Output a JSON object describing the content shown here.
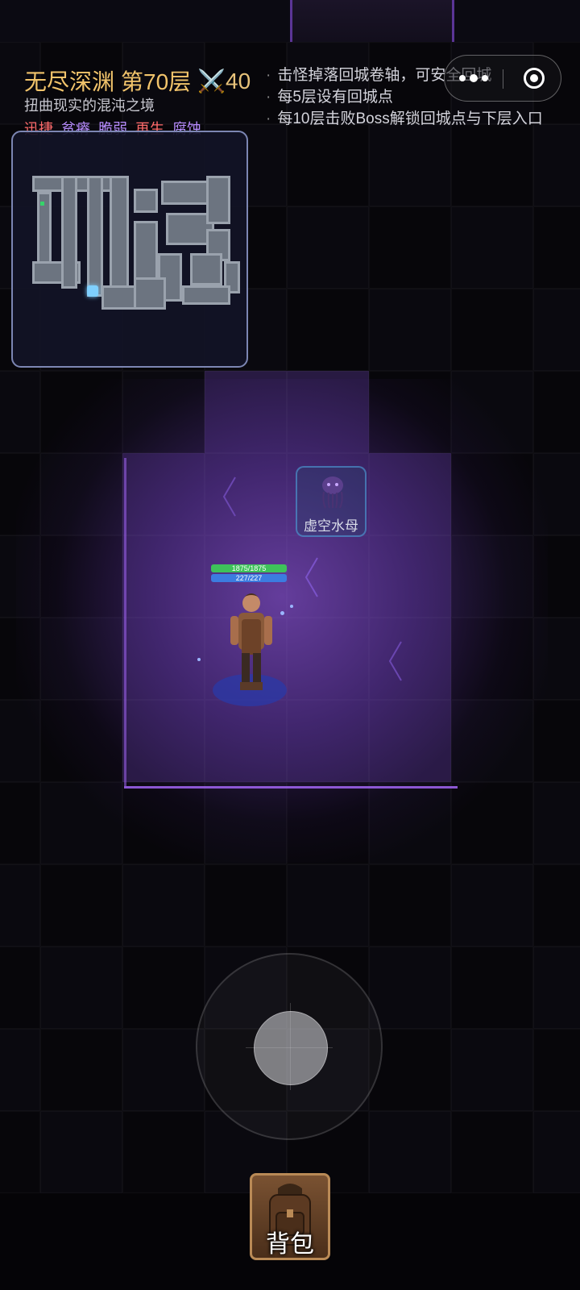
{
  "hud": {
    "dungeon_name": "无尽深渊",
    "floor": "第70层",
    "power": "⚔️40",
    "subtitle": "扭曲现实的混沌之境",
    "affixes": [
      {
        "label": "迅捷",
        "color": "#ff6b6b"
      },
      {
        "label": "贫瘠",
        "color": "#b88cff"
      },
      {
        "label": "脆弱",
        "color": "#b88cff"
      },
      {
        "label": "再生",
        "color": "#ff6b6b"
      },
      {
        "label": "腐蚀",
        "color": "#b88cff"
      }
    ]
  },
  "tips": [
    "击怪掉落回城卷轴，可安全回城",
    "每5层设有回城点",
    "每10层击败Boss解锁回城点与下层入口"
  ],
  "capsule": {
    "menu_icon": "more-dots-icon",
    "close_icon": "target-close-icon"
  },
  "monster": {
    "name": "虚空水母",
    "icon": "jellyfish-icon"
  },
  "player": {
    "hp": "1875/1875",
    "mp": "227/227",
    "hp_fraction": 1.0,
    "mp_fraction": 1.0
  },
  "bag": {
    "label": "背包",
    "icon": "backpack-icon"
  },
  "colors": {
    "accent_purple": "#8a52e0",
    "hp_green": "#3ec25a",
    "mp_blue": "#3c7ce0",
    "title_gold": "#f2c46b"
  }
}
